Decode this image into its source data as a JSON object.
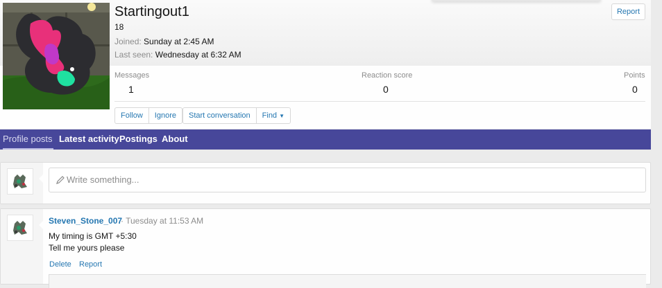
{
  "profile": {
    "username": "Startingout1",
    "title": "18",
    "joined_label": "Joined:",
    "joined_value": "Sunday at 2:45 AM",
    "last_seen_label": "Last seen:",
    "last_seen_value": "Wednesday at 6:32 AM",
    "report_label": "Report"
  },
  "stats": {
    "messages_label": "Messages",
    "messages_value": "1",
    "reaction_label": "Reaction score",
    "reaction_value": "0",
    "points_label": "Points",
    "points_value": "0"
  },
  "actions": {
    "follow": "Follow",
    "ignore": "Ignore",
    "start_conversation": "Start conversation",
    "find": "Find"
  },
  "tabs": [
    {
      "label": "Profile posts"
    },
    {
      "label": "Latest activity"
    },
    {
      "label": "Postings"
    },
    {
      "label": "About"
    }
  ],
  "composer": {
    "placeholder": "Write something..."
  },
  "post": {
    "author": "Steven_Stone_007",
    "separator_time": "· Tuesday at 11:53 AM",
    "line1": "My timing is GMT +5:30",
    "line2": "Tell me yours please",
    "delete_label": "Delete",
    "report_label": "Report"
  },
  "colors": {
    "tab_bar": "#47479a",
    "link": "#2577b1"
  }
}
